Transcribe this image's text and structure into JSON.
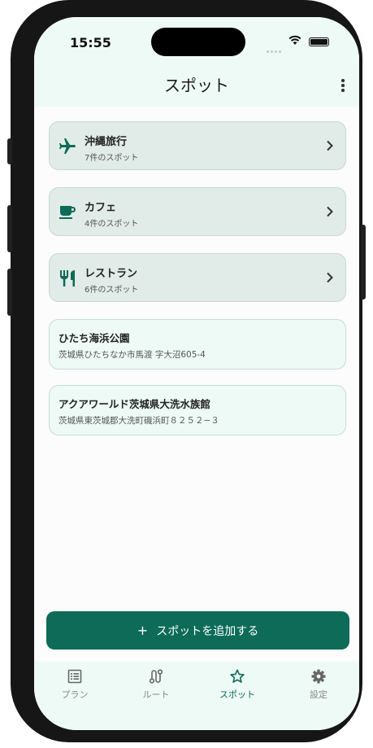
{
  "status_bar": {
    "time": "15:55"
  },
  "header": {
    "title": "スポット"
  },
  "categories": [
    {
      "title": "沖縄旅行",
      "subtitle": "7件のスポット",
      "icon": "airplane-icon"
    },
    {
      "title": "カフェ",
      "subtitle": "4件のスポット",
      "icon": "coffee-cup-icon"
    },
    {
      "title": "レストラン",
      "subtitle": "6件のスポット",
      "icon": "restaurant-icon"
    }
  ],
  "spots": [
    {
      "title": "ひたち海浜公園",
      "address": "茨城県ひたちなか市馬渡 字大沼605-4"
    },
    {
      "title": "アクアワールド茨城県大洗水族館",
      "address": "茨城県東茨城郡大洗町磯浜町８２５２−３"
    }
  ],
  "add_button": {
    "icon": "plus-icon",
    "label": "スポットを追加する"
  },
  "tabs": [
    {
      "label": "プラン",
      "icon": "list-icon"
    },
    {
      "label": "ルート",
      "icon": "route-icon"
    },
    {
      "label": "スポット",
      "icon": "star-icon",
      "active": true
    },
    {
      "label": "設定",
      "icon": "gear-icon"
    }
  ],
  "colors": {
    "accent": "#0d6b58",
    "header_bg": "#eefaf5",
    "category_bg": "#e1ebe7",
    "spot_bg": "#eefaf6"
  }
}
